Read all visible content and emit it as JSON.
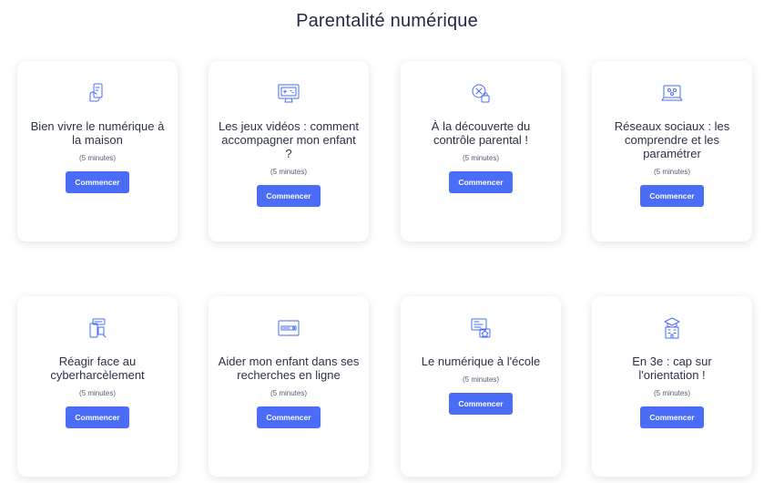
{
  "page": {
    "title": "Parentalité numérique"
  },
  "cards": [
    {
      "title": "Bien vivre le numérique à la maison",
      "duration": "(5 minutes)",
      "button": "Commencer",
      "icon": "hand-phone-icon"
    },
    {
      "title": "Les jeux vidéos : comment accompagner mon enfant ?",
      "duration": "(5 minutes)",
      "button": "Commencer",
      "icon": "monitor-game-icon"
    },
    {
      "title": "À la découverte du contrôle parental !",
      "duration": "(5 minutes)",
      "button": "Commencer",
      "icon": "parental-lock-icon"
    },
    {
      "title": "Réseaux sociaux : les comprendre et les paramétrer",
      "duration": "(5 minutes)",
      "button": "Commencer",
      "icon": "laptop-social-icon"
    },
    {
      "title": "Réagir face au cyberharcèlement",
      "duration": "(5 minutes)",
      "button": "Commencer",
      "icon": "phone-message-icon"
    },
    {
      "title": "Aider mon enfant dans ses recherches en ligne",
      "duration": "(5 minutes)",
      "button": "Commencer",
      "icon": "search-bar-icon"
    },
    {
      "title": "Le numérique à l'école",
      "duration": "(5 minutes)",
      "button": "Commencer",
      "icon": "school-screen-icon"
    },
    {
      "title": "En 3e : cap sur l'orientation !",
      "duration": "(5 minutes)",
      "button": "Commencer",
      "icon": "graduation-building-icon"
    }
  ],
  "colors": {
    "accent": "#4a6cf7",
    "title": "#1f2a44"
  }
}
